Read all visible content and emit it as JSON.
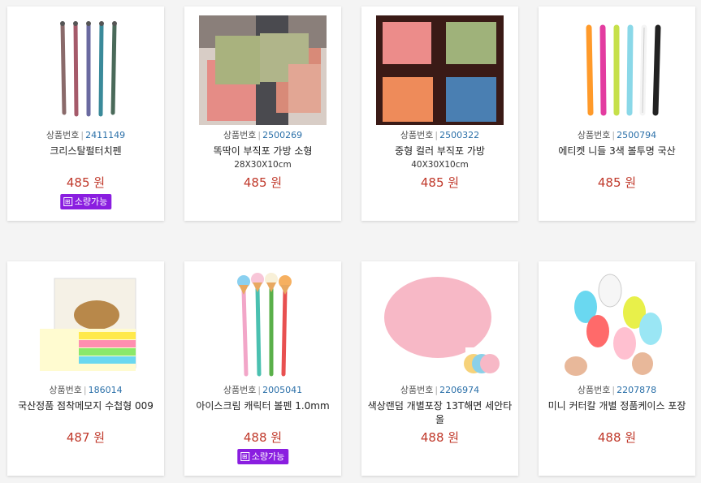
{
  "code_label": "상품번호",
  "products": [
    {
      "code": "2411149",
      "name": "크리스탈펄터치펜",
      "sub": "",
      "price": "485 원",
      "badge": "소량가능",
      "image": "pens-metallic"
    },
    {
      "code": "2500269",
      "name": "똑딱이 부직포 가방 소형",
      "sub": "28X30X10cm",
      "price": "485 원",
      "badge": "",
      "image": "shopping-bags"
    },
    {
      "code": "2500322",
      "name": "중형 컬러 부직포 가방",
      "sub": "40X30X10cm",
      "price": "485 원",
      "badge": "",
      "image": "color-bags"
    },
    {
      "code": "2500794",
      "name": "에티켓 니들 3색 볼투명 국산",
      "sub": "",
      "price": "485 원",
      "badge": "",
      "image": "multicolor-pens"
    },
    {
      "code": "186014",
      "name": "국산정품 점착메모지 수첩형 009",
      "sub": "",
      "price": "487 원",
      "badge": "",
      "image": "sticky-memo"
    },
    {
      "code": "2005041",
      "name": "아이스크림 캐릭터 볼펜 1.0mm",
      "sub": "",
      "price": "488 원",
      "badge": "소량가능",
      "image": "icecream-pens"
    },
    {
      "code": "2206974",
      "name": "색상랜덤 개별포장 13T해면 세안타올",
      "sub": "",
      "price": "488 원",
      "badge": "",
      "image": "sponge"
    },
    {
      "code": "2207878",
      "name": "미니 커터칼 개별 정품케이스 포장",
      "sub": "",
      "price": "488 원",
      "badge": "",
      "image": "mini-cutter"
    }
  ]
}
